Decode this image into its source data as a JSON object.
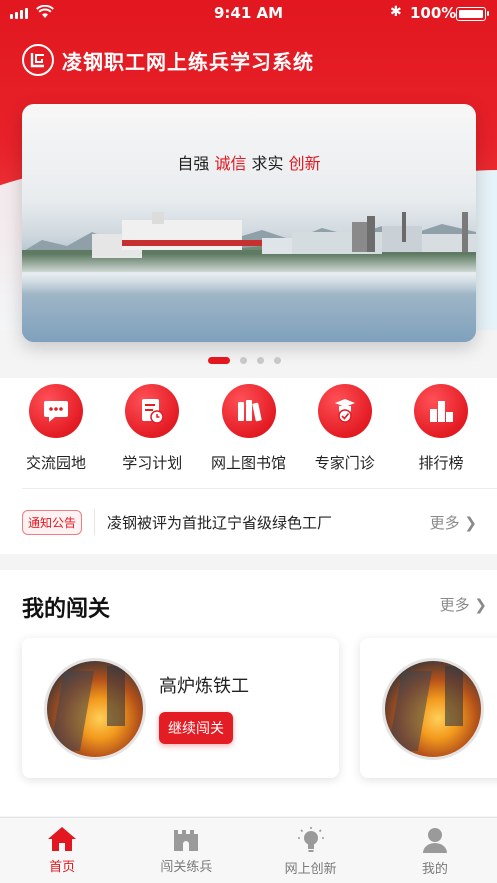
{
  "status_bar": {
    "time": "9:41 AM",
    "battery": "100%"
  },
  "app": {
    "title": "凌钢职工网上练兵学习系统",
    "logo_text": "LG"
  },
  "banner": {
    "slogan_1": "自强",
    "slogan_2": "诚信",
    "slogan_3": "求实",
    "slogan_4": "创新",
    "page_count": 4,
    "active_page": 1
  },
  "quick_menu": [
    {
      "label": "交流园地",
      "icon": "chat-icon"
    },
    {
      "label": "学习计划",
      "icon": "study-plan-icon"
    },
    {
      "label": "网上图书馆",
      "icon": "library-icon"
    },
    {
      "label": "专家门诊",
      "icon": "expert-icon"
    },
    {
      "label": "排行榜",
      "icon": "ranking-icon"
    }
  ],
  "notice": {
    "badge": "通知公告",
    "text": "凌钢被评为首批辽宁省级绿色工厂",
    "more": "更多"
  },
  "my_challenge": {
    "title": "我的闯关",
    "more": "更多",
    "cards": [
      {
        "name": "高炉炼铁工",
        "button": "继续闯关"
      }
    ]
  },
  "tabbar": [
    {
      "label": "首页",
      "icon": "home-icon",
      "active": true
    },
    {
      "label": "闯关练兵",
      "icon": "castle-icon",
      "active": false
    },
    {
      "label": "网上创新",
      "icon": "lightbulb-icon",
      "active": false
    },
    {
      "label": "我的",
      "icon": "user-icon",
      "active": false
    }
  ],
  "colors": {
    "brand_red": "#e2171f",
    "tab_inactive": "#7a7a7a"
  }
}
